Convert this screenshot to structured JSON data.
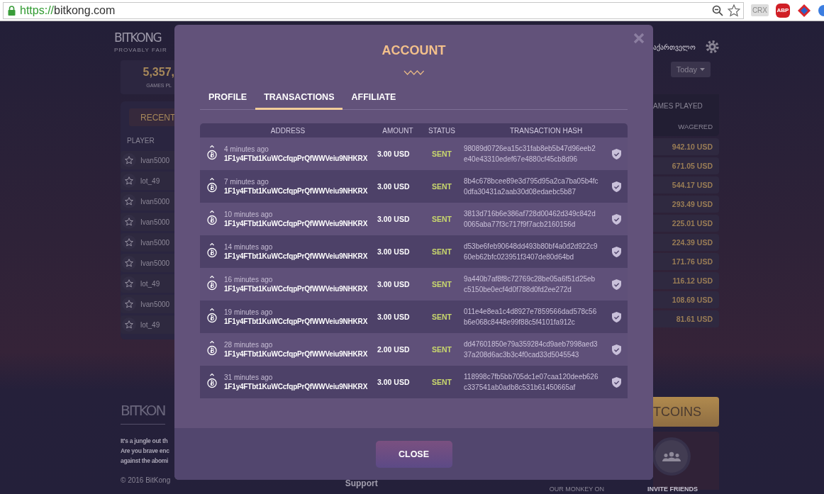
{
  "browser": {
    "url_scheme": "https://",
    "url_host": "bitkong.com",
    "extensions": [
      "CRX",
      "ABP"
    ]
  },
  "site": {
    "logo": "BITKONG",
    "tagline": "PROVABLY FAIR",
    "stat_value": "5,357,",
    "stat_label": "GAMES PL",
    "language": "აქართველო",
    "period_button": "Today"
  },
  "recent_panel": {
    "tab": "RECENT",
    "column": "PLAYER",
    "players": [
      "Ivan5000",
      "lot_49",
      "Ivan5000",
      "Ivan5000",
      "Ivan5000",
      "Ivan5000",
      "lot_49",
      "Ivan5000",
      "lot_49"
    ]
  },
  "games_panel": {
    "title": "AMES PLAYED",
    "column": "WAGERED",
    "values": [
      "942.10 USD",
      "671.05 USD",
      "544.17 USD",
      "293.49 USD",
      "225.01 USD",
      "224.39 USD",
      "171.76 USD",
      "116.12 USD",
      "108.69 USD",
      "81.61 USD"
    ]
  },
  "footer": {
    "logo": "BITKON",
    "text_lines": [
      "It's a jungle out th",
      "Are you brave enc",
      "against the abomi"
    ],
    "copyright": "© 2016 BitKong",
    "link": "Support",
    "social_heading": "OUR MONKEY ON",
    "buy_button": "TCOINS",
    "invite_label": "INVITE FRIENDS"
  },
  "modal": {
    "title": "ACCOUNT",
    "tabs": [
      {
        "label": "PROFILE",
        "selected": false
      },
      {
        "label": "TRANSACTIONS",
        "selected": true
      },
      {
        "label": "AFFILIATE",
        "selected": false
      }
    ],
    "columns": [
      "ADDRESS",
      "AMOUNT",
      "STATUS",
      "TRANSACTION HASH"
    ],
    "rows": [
      {
        "time": "4 minutes ago",
        "address": "1F1y4FTbt1KuWCcfqpPrQfWWVeiu9NHKRX",
        "amount": "3.00 USD",
        "status": "SENT",
        "hash": "98089d0726ea15c31fab8eb5b47d96eeb2e40e43310edef67e4880cf45cb8d96"
      },
      {
        "time": "7 minutes ago",
        "address": "1F1y4FTbt1KuWCcfqpPrQfWWVeiu9NHKRX",
        "amount": "3.00 USD",
        "status": "SENT",
        "hash": "8b4c678bcee89e3d795d95a2ca7ba05b4fc0dfa30431a2aab30d08edaebc5b87"
      },
      {
        "time": "10 minutes ago",
        "address": "1F1y4FTbt1KuWCcfqpPrQfWWVeiu9NHKRX",
        "amount": "3.00 USD",
        "status": "SENT",
        "hash": "3813d716b6e386af728d00462d349c842d0065aba77f3c717f9f7acb2160156d"
      },
      {
        "time": "14 minutes ago",
        "address": "1F1y4FTbt1KuWCcfqpPrQfWWVeiu9NHKRX",
        "amount": "3.00 USD",
        "status": "SENT",
        "hash": "d53be6feb90648dd493b80bf4a0d2d922c960eb62bfc023951f3407de80d64bd"
      },
      {
        "time": "16 minutes ago",
        "address": "1F1y4FTbt1KuWCcfqpPrQfWWVeiu9NHKRX",
        "amount": "3.00 USD",
        "status": "SENT",
        "hash": "9a440b7af8f8c72769c28be05a6f51d25ebc5150be0ecf4d0f788d0fd2ee272d"
      },
      {
        "time": "19 minutes ago",
        "address": "1F1y4FTbt1KuWCcfqpPrQfWWVeiu9NHKRX",
        "amount": "3.00 USD",
        "status": "SENT",
        "hash": "011e4e8ea1c4d8927e7859566dad578c56b6e068c8448e99f88c5f4101fa912c"
      },
      {
        "time": "28 minutes ago",
        "address": "1F1y4FTbt1KuWCcfqpPrQfWWVeiu9NHKRX",
        "amount": "2.00 USD",
        "status": "SENT",
        "hash": "dd47601850e79a359284cd9aeb7998aed337a208d6ac3b3c4f0cad33d5045543"
      },
      {
        "time": "31 minutes ago",
        "address": "1F1y4FTbt1KuWCcfqpPrQfWWVeiu9NHKRX",
        "amount": "3.00 USD",
        "status": "SENT",
        "hash": "118998c7fb5bb705dc1e07caa120deeb626c337541ab0adb8c531b61450665af"
      }
    ],
    "close_button": "CLOSE"
  }
}
